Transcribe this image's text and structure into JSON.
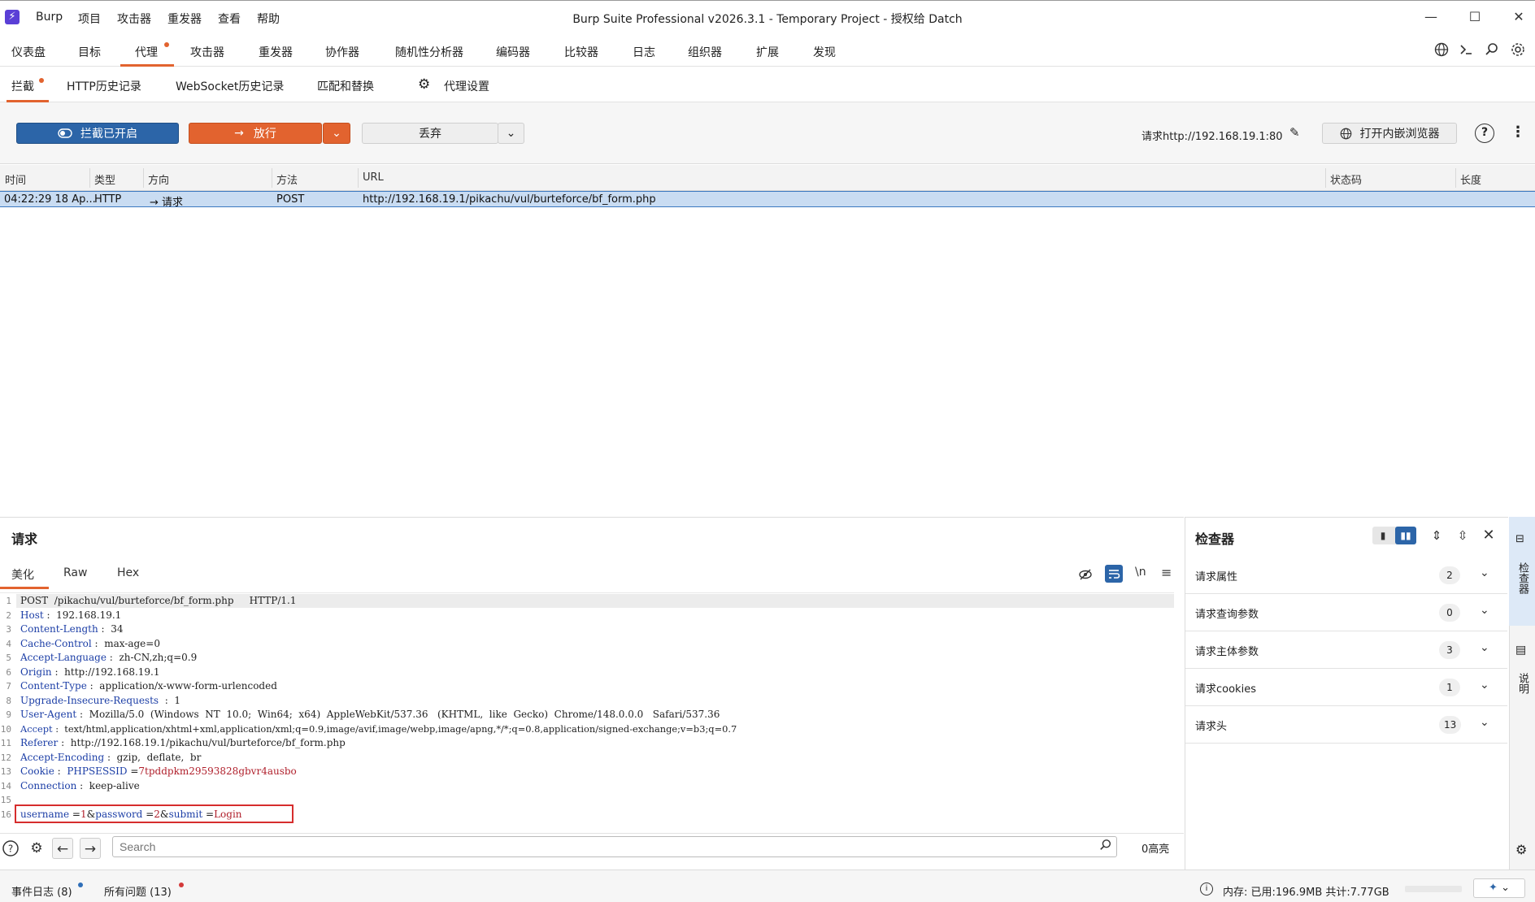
{
  "window": {
    "title": "Burp Suite Professional v2026.3.1 - Temporary Project - 授权给 Datch",
    "minimize": "—",
    "maximize": "☐",
    "close": "✕"
  },
  "menu": [
    "Burp",
    "项目",
    "攻击器",
    "重发器",
    "查看",
    "帮助"
  ],
  "main_tabs": [
    "仪表盘",
    "目标",
    "代理",
    "攻击器",
    "重发器",
    "协作器",
    "随机性分析器",
    "编码器",
    "比较器",
    "日志",
    "组织器",
    "扩展",
    "发现"
  ],
  "main_tabs_active": "代理",
  "sub_tabs": [
    "拦截",
    "HTTP历史记录",
    "WebSocket历史记录",
    "匹配和替换",
    "代理设置"
  ],
  "toolbar": {
    "intercept_label": "拦截已开启",
    "forward_label": "放行",
    "drop_label": "丢弃",
    "request_target": "请求http://192.168.19.1:80",
    "browser_label": "打开内嵌浏览器"
  },
  "table": {
    "columns": [
      "时间",
      "类型",
      "方向",
      "方法",
      "URL",
      "状态码",
      "长度"
    ],
    "rows": [
      {
        "time": "04:22:29 18 Ap...",
        "type": "HTTP",
        "direction": "→  请求",
        "method": "POST",
        "url": "http://192.168.19.1/pikachu/vul/burteforce/bf_form.php",
        "status": "",
        "length": ""
      }
    ]
  },
  "request": {
    "title": "请求",
    "tabs": [
      "美化",
      "Raw",
      "Hex"
    ],
    "active_tab": "美化",
    "line_numbers": [
      "1",
      "2",
      "3",
      "4",
      "5",
      "6",
      "7",
      "8",
      "9",
      "10",
      "11",
      "12",
      "13",
      "14",
      "15",
      "16"
    ],
    "line1": "POST  /pikachu/vul/burteforce/bf_form.php     HTTP/1.1",
    "headers": [
      {
        "name": "Host",
        "value": " :  192.168.19.1"
      },
      {
        "name": "Content-Length",
        "value": " :  34"
      },
      {
        "name": "Cache-Control",
        "value": " :  max-age=0"
      },
      {
        "name": "Accept-Language",
        "value": " :  zh-CN,zh;q=0.9"
      },
      {
        "name": "Origin",
        "value": " :  http://192.168.19.1"
      },
      {
        "name": "Content-Type",
        "value": " :  application/x-www-form-urlencoded"
      },
      {
        "name": "Upgrade-Insecure-Requests",
        "value": "  :  1"
      },
      {
        "name": "User-Agent",
        "value": " :  Mozilla/5.0  (Windows  NT  10.0;  Win64;  x64)  AppleWebKit/537.36   (KHTML,  like  Gecko)  Chrome/148.0.0.0   Safari/537.36"
      },
      {
        "name": "Accept",
        "value": " :  text/html,application/xhtml+xml,application/xml;q=0.9,image/avif,image/webp,image/apng,*/*;q=0.8,application/signed-exchange;v=b3;q=0.7"
      },
      {
        "name": "Referer",
        "value": " :  http://192.168.19.1/pikachu/vul/burteforce/bf_form.php"
      },
      {
        "name": "Accept-Encoding",
        "value": " :  gzip,  deflate,  br"
      }
    ],
    "cookie_name": "Cookie",
    "cookie_key": "PHPSESSID",
    "cookie_val": "7tpddpkm29593828gbvr4ausbo",
    "connection_name": "Connection",
    "connection_value": " :  keep-alive",
    "body": {
      "k1": "username",
      "v1": "1",
      "k2": "password",
      "v2": "2",
      "k3": "submit",
      "v3": "Login"
    },
    "search_placeholder": "Search",
    "highlights": "0高亮"
  },
  "inspector": {
    "title": "检查器",
    "sections": [
      {
        "label": "请求属性",
        "count": "2"
      },
      {
        "label": "请求查询参数",
        "count": "0"
      },
      {
        "label": "请求主体参数",
        "count": "3"
      },
      {
        "label": "请求cookies",
        "count": "1"
      },
      {
        "label": "请求头",
        "count": "13"
      }
    ]
  },
  "right_sidebar": [
    "检查器",
    "说明"
  ],
  "statusbar": {
    "event_log": "事件日志 (8)",
    "issues": "所有问题 (13)",
    "memory": "内存: 已用:196.9MB 共计:7.77GB"
  },
  "colors": {
    "accent": "#e2632f",
    "intercept_blue": "#2c65a8",
    "selected_row": "#c9dcf2",
    "header_name": "#1c3ea6",
    "string_value": "#b0202c",
    "highlight_box": "#d62d2d"
  }
}
